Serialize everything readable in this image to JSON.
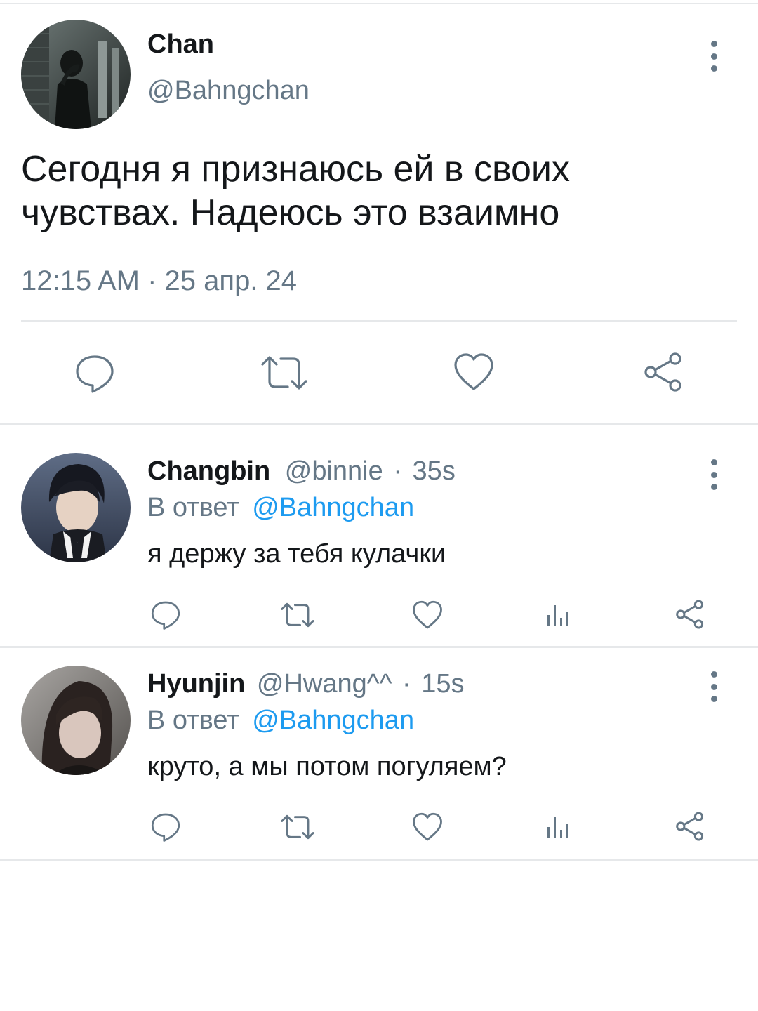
{
  "main_tweet": {
    "display_name": "Chan",
    "handle": "@Bahngchan",
    "text": "Сегодня я признаюсь ей в своих чувствах. Надеюсь это взаимно",
    "timestamp": "12:15 AM · 25 апр. 24",
    "actions": [
      "reply-icon",
      "retweet-icon",
      "like-icon",
      "share-icon"
    ],
    "more_icon": "more-vertical-icon"
  },
  "replies": [
    {
      "display_name": "Changbin",
      "handle": "@binnie",
      "separator": "·",
      "time": "35s",
      "reply_prefix": "В ответ",
      "reply_to": "@Bahngchan",
      "text": "я держу за тебя кулачки",
      "actions": [
        "reply-icon",
        "retweet-icon",
        "like-icon",
        "views-icon",
        "share-icon"
      ]
    },
    {
      "display_name": "Hyunjin",
      "handle": "@Hwang^^",
      "separator": "·",
      "time": "15s",
      "reply_prefix": "В ответ",
      "reply_to": "@Bahngchan",
      "text": "круто, а мы потом погуляем?",
      "actions": [
        "reply-icon",
        "retweet-icon",
        "like-icon",
        "views-icon",
        "share-icon"
      ]
    }
  ],
  "colors": {
    "primary_text": "#14171a",
    "secondary_text": "#657786",
    "link": "#1d9bf0",
    "divider": "#e6e8ea",
    "background": "#ffffff"
  }
}
